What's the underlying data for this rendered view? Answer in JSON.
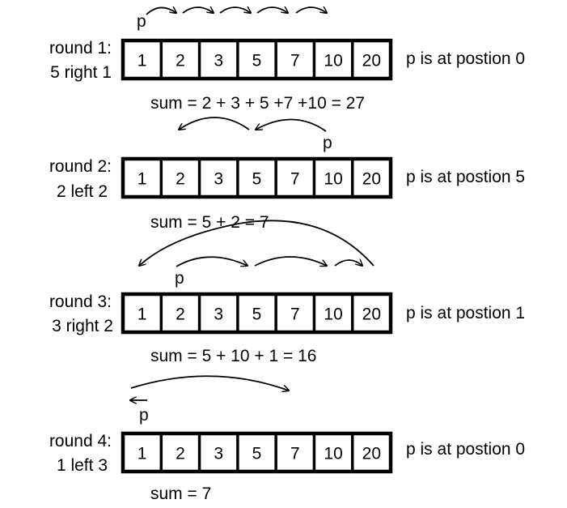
{
  "array": [
    "1",
    "2",
    "3",
    "5",
    "7",
    "10",
    "20"
  ],
  "pointer_label": "p",
  "rounds": [
    {
      "title": "round 1:",
      "subtitle": "5 right 1",
      "position": "p is at postion 0",
      "sum": "sum = 2 + 3 + 5 +7 +10  = 27"
    },
    {
      "title": "round 2:",
      "subtitle": "2 left 2",
      "position": "p is at postion 5",
      "sum": "sum =  5 + 2 = 7"
    },
    {
      "title": "round 3:",
      "subtitle": "3 right 2",
      "position": "p is at postion 1",
      "sum": "sum =  5 + 10 + 1 = 16"
    },
    {
      "title": "round 4:",
      "subtitle": "1 left 3",
      "position": "p is at postion 0",
      "sum": "sum =  7"
    }
  ]
}
